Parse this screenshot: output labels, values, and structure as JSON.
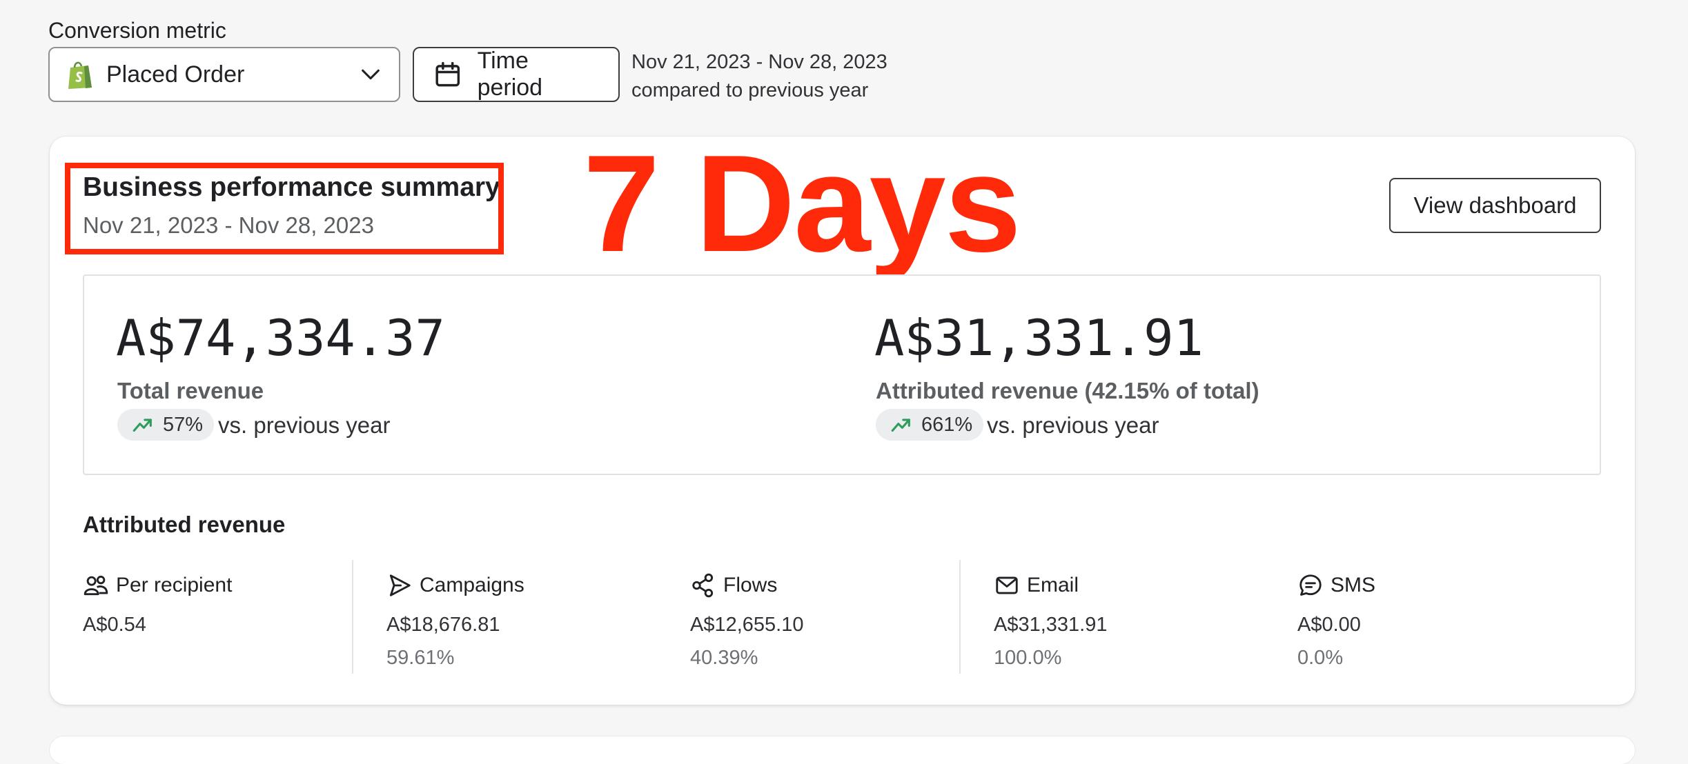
{
  "filters": {
    "conversion_metric_label": "Conversion metric",
    "selected_metric": "Placed Order",
    "time_period_label": "Time period",
    "period_range": "Nov 21, 2023 - Nov 28, 2023",
    "period_comparison": "compared to previous year"
  },
  "summary": {
    "title": "Business performance summary",
    "date_range": "Nov 21, 2023 - Nov 28, 2023",
    "overlay_annotation": "7 Days",
    "view_dashboard_label": "View dashboard",
    "annotation_color": "#ff2a0a"
  },
  "metrics": [
    {
      "value": "A$74,334.37",
      "label": "Total revenue",
      "change": "57%",
      "change_suffix": "vs. previous year",
      "trend": "up"
    },
    {
      "value": "A$31,331.91",
      "label": "Attributed revenue (42.15% of total)",
      "change": "661%",
      "change_suffix": "vs. previous year",
      "trend": "up"
    }
  ],
  "attributed": {
    "title": "Attributed revenue",
    "columns": [
      {
        "icon": "people-icon",
        "label": "Per recipient",
        "value": "A$0.54",
        "percent": ""
      },
      {
        "icon": "send-icon",
        "label": "Campaigns",
        "value": "A$18,676.81",
        "percent": "59.61%"
      },
      {
        "icon": "flows-icon",
        "label": "Flows",
        "value": "A$12,655.10",
        "percent": "40.39%"
      },
      {
        "icon": "email-icon",
        "label": "Email",
        "value": "A$31,331.91",
        "percent": "100.0%"
      },
      {
        "icon": "sms-icon",
        "label": "SMS",
        "value": "A$0.00",
        "percent": "0.0%"
      }
    ]
  },
  "colors": {
    "trend_up": "#2e9d5b",
    "shopify_green": "#95bf47"
  }
}
